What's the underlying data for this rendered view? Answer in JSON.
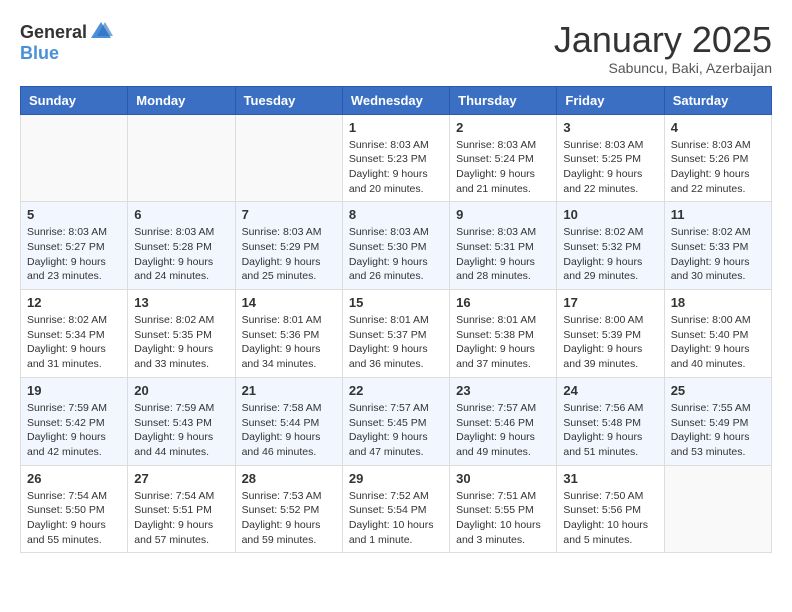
{
  "logo": {
    "general": "General",
    "blue": "Blue"
  },
  "header": {
    "month": "January 2025",
    "location": "Sabuncu, Baki, Azerbaijan"
  },
  "days_of_week": [
    "Sunday",
    "Monday",
    "Tuesday",
    "Wednesday",
    "Thursday",
    "Friday",
    "Saturday"
  ],
  "weeks": [
    [
      {
        "day": "",
        "info": ""
      },
      {
        "day": "",
        "info": ""
      },
      {
        "day": "",
        "info": ""
      },
      {
        "day": "1",
        "info": "Sunrise: 8:03 AM\nSunset: 5:23 PM\nDaylight: 9 hours\nand 20 minutes."
      },
      {
        "day": "2",
        "info": "Sunrise: 8:03 AM\nSunset: 5:24 PM\nDaylight: 9 hours\nand 21 minutes."
      },
      {
        "day": "3",
        "info": "Sunrise: 8:03 AM\nSunset: 5:25 PM\nDaylight: 9 hours\nand 22 minutes."
      },
      {
        "day": "4",
        "info": "Sunrise: 8:03 AM\nSunset: 5:26 PM\nDaylight: 9 hours\nand 22 minutes."
      }
    ],
    [
      {
        "day": "5",
        "info": "Sunrise: 8:03 AM\nSunset: 5:27 PM\nDaylight: 9 hours\nand 23 minutes."
      },
      {
        "day": "6",
        "info": "Sunrise: 8:03 AM\nSunset: 5:28 PM\nDaylight: 9 hours\nand 24 minutes."
      },
      {
        "day": "7",
        "info": "Sunrise: 8:03 AM\nSunset: 5:29 PM\nDaylight: 9 hours\nand 25 minutes."
      },
      {
        "day": "8",
        "info": "Sunrise: 8:03 AM\nSunset: 5:30 PM\nDaylight: 9 hours\nand 26 minutes."
      },
      {
        "day": "9",
        "info": "Sunrise: 8:03 AM\nSunset: 5:31 PM\nDaylight: 9 hours\nand 28 minutes."
      },
      {
        "day": "10",
        "info": "Sunrise: 8:02 AM\nSunset: 5:32 PM\nDaylight: 9 hours\nand 29 minutes."
      },
      {
        "day": "11",
        "info": "Sunrise: 8:02 AM\nSunset: 5:33 PM\nDaylight: 9 hours\nand 30 minutes."
      }
    ],
    [
      {
        "day": "12",
        "info": "Sunrise: 8:02 AM\nSunset: 5:34 PM\nDaylight: 9 hours\nand 31 minutes."
      },
      {
        "day": "13",
        "info": "Sunrise: 8:02 AM\nSunset: 5:35 PM\nDaylight: 9 hours\nand 33 minutes."
      },
      {
        "day": "14",
        "info": "Sunrise: 8:01 AM\nSunset: 5:36 PM\nDaylight: 9 hours\nand 34 minutes."
      },
      {
        "day": "15",
        "info": "Sunrise: 8:01 AM\nSunset: 5:37 PM\nDaylight: 9 hours\nand 36 minutes."
      },
      {
        "day": "16",
        "info": "Sunrise: 8:01 AM\nSunset: 5:38 PM\nDaylight: 9 hours\nand 37 minutes."
      },
      {
        "day": "17",
        "info": "Sunrise: 8:00 AM\nSunset: 5:39 PM\nDaylight: 9 hours\nand 39 minutes."
      },
      {
        "day": "18",
        "info": "Sunrise: 8:00 AM\nSunset: 5:40 PM\nDaylight: 9 hours\nand 40 minutes."
      }
    ],
    [
      {
        "day": "19",
        "info": "Sunrise: 7:59 AM\nSunset: 5:42 PM\nDaylight: 9 hours\nand 42 minutes."
      },
      {
        "day": "20",
        "info": "Sunrise: 7:59 AM\nSunset: 5:43 PM\nDaylight: 9 hours\nand 44 minutes."
      },
      {
        "day": "21",
        "info": "Sunrise: 7:58 AM\nSunset: 5:44 PM\nDaylight: 9 hours\nand 46 minutes."
      },
      {
        "day": "22",
        "info": "Sunrise: 7:57 AM\nSunset: 5:45 PM\nDaylight: 9 hours\nand 47 minutes."
      },
      {
        "day": "23",
        "info": "Sunrise: 7:57 AM\nSunset: 5:46 PM\nDaylight: 9 hours\nand 49 minutes."
      },
      {
        "day": "24",
        "info": "Sunrise: 7:56 AM\nSunset: 5:48 PM\nDaylight: 9 hours\nand 51 minutes."
      },
      {
        "day": "25",
        "info": "Sunrise: 7:55 AM\nSunset: 5:49 PM\nDaylight: 9 hours\nand 53 minutes."
      }
    ],
    [
      {
        "day": "26",
        "info": "Sunrise: 7:54 AM\nSunset: 5:50 PM\nDaylight: 9 hours\nand 55 minutes."
      },
      {
        "day": "27",
        "info": "Sunrise: 7:54 AM\nSunset: 5:51 PM\nDaylight: 9 hours\nand 57 minutes."
      },
      {
        "day": "28",
        "info": "Sunrise: 7:53 AM\nSunset: 5:52 PM\nDaylight: 9 hours\nand 59 minutes."
      },
      {
        "day": "29",
        "info": "Sunrise: 7:52 AM\nSunset: 5:54 PM\nDaylight: 10 hours\nand 1 minute."
      },
      {
        "day": "30",
        "info": "Sunrise: 7:51 AM\nSunset: 5:55 PM\nDaylight: 10 hours\nand 3 minutes."
      },
      {
        "day": "31",
        "info": "Sunrise: 7:50 AM\nSunset: 5:56 PM\nDaylight: 10 hours\nand 5 minutes."
      },
      {
        "day": "",
        "info": ""
      }
    ]
  ]
}
